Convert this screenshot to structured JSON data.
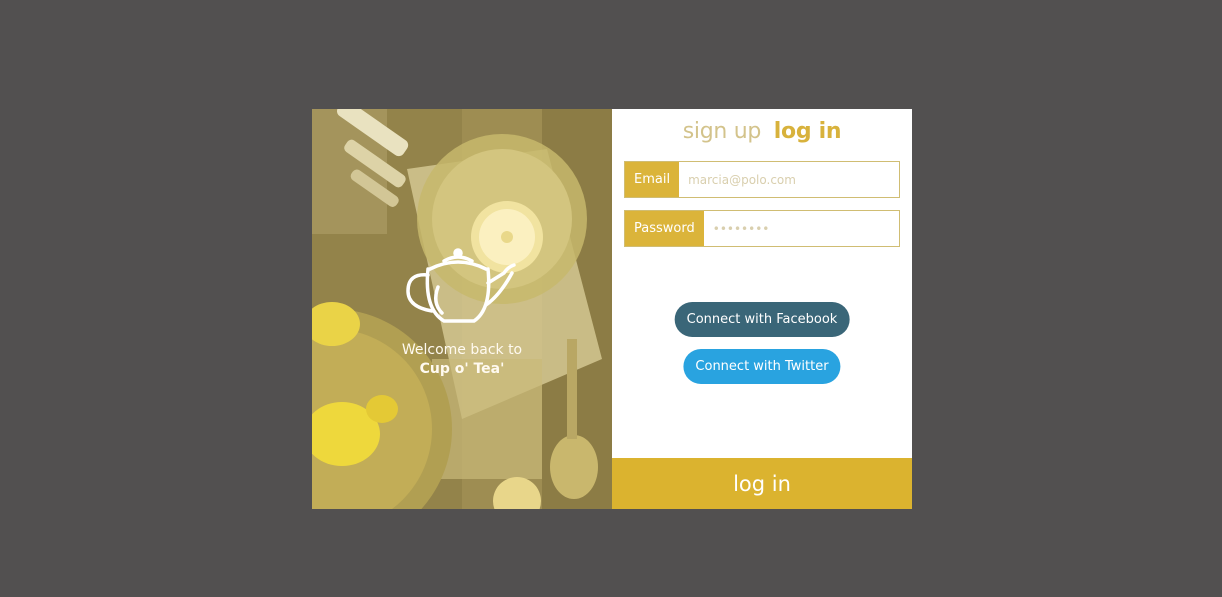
{
  "welcome": {
    "line1": "Welcome back to",
    "brand": "Cup o' Tea'"
  },
  "tabs": {
    "signup": "sign up",
    "login": "log in",
    "active": "login"
  },
  "fields": {
    "email": {
      "label": "Email",
      "placeholder": "marcia@polo.com",
      "value": ""
    },
    "password": {
      "label": "Password",
      "placeholder": "••••••••",
      "value": ""
    }
  },
  "social": {
    "facebook": "Connect with Facebook",
    "twitter": "Connect with Twitter"
  },
  "submit": {
    "label": "log in"
  },
  "icons": {
    "teapot": "teapot-icon"
  },
  "colors": {
    "backdrop": "#525050",
    "accent": "#dbb32f",
    "facebook": "#3a6678",
    "twitter": "#29a3e0"
  }
}
